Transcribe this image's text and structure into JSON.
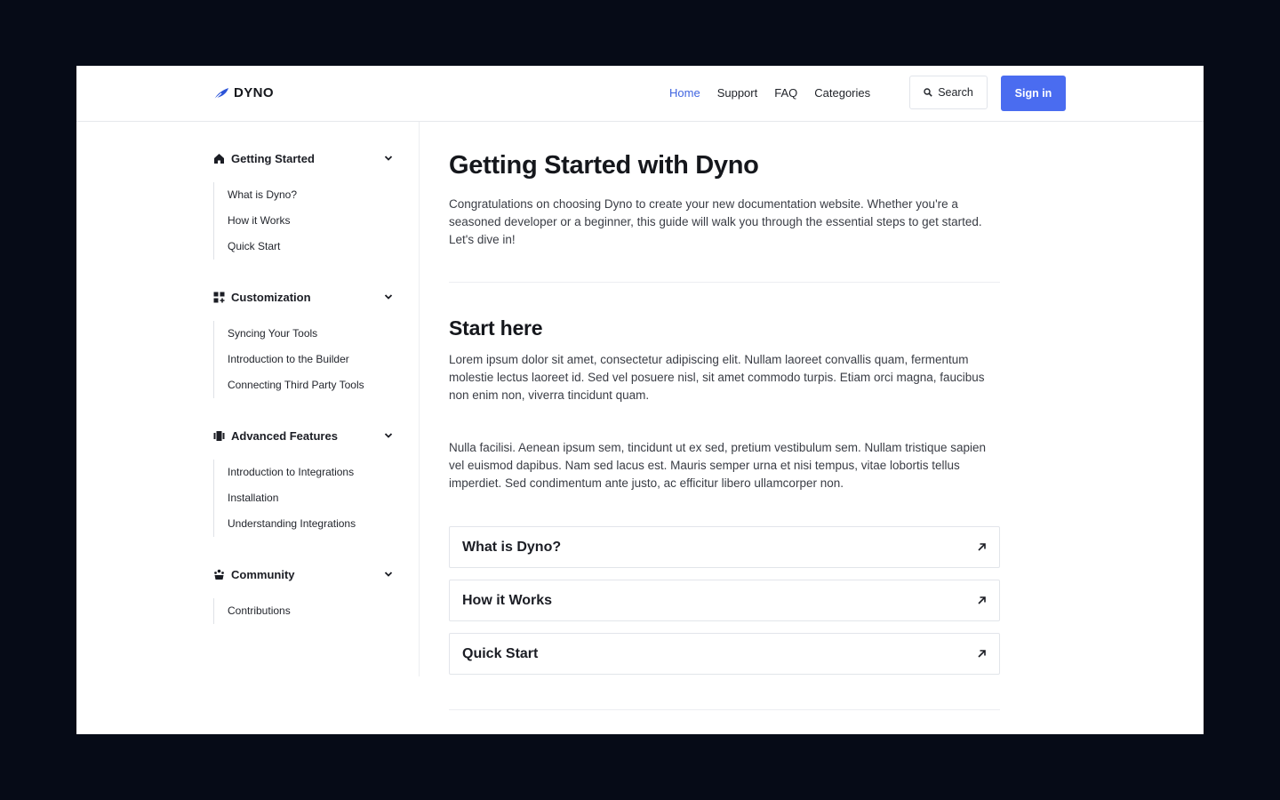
{
  "brand": {
    "name": "DYNO",
    "accent": "#3f64e0",
    "button_color": "#4a6cf0"
  },
  "header": {
    "nav": [
      {
        "label": "Home",
        "active": true
      },
      {
        "label": "Support",
        "active": false
      },
      {
        "label": "FAQ",
        "active": false
      },
      {
        "label": "Categories",
        "active": false
      }
    ],
    "search_label": "Search",
    "signin_label": "Sign in"
  },
  "sidebar": {
    "sections": [
      {
        "label": "Getting Started",
        "icon": "home-icon",
        "items": [
          "What is Dyno?",
          "How it Works",
          "Quick Start"
        ]
      },
      {
        "label": "Customization",
        "icon": "grid-plus-icon",
        "items": [
          "Syncing Your Tools",
          "Introduction to the Builder",
          "Connecting Third Party Tools"
        ]
      },
      {
        "label": "Advanced Features",
        "icon": "carousel-icon",
        "items": [
          "Introduction to Integrations",
          "Installation",
          "Understanding Integrations"
        ]
      },
      {
        "label": "Community",
        "icon": "community-icon",
        "items": [
          "Contributions"
        ]
      }
    ]
  },
  "main": {
    "title": "Getting Started with Dyno",
    "lead": "Congratulations on choosing Dyno to create your new documentation website. Whether you're a seasoned developer or a beginner, this guide will walk you through the essential steps to get started. Let's dive in!",
    "section_title": "Start here",
    "paragraphs": [
      "Lorem ipsum dolor sit amet, consectetur adipiscing elit. Nullam laoreet convallis quam, fermentum molestie lectus laoreet id. Sed vel posuere nisl, sit amet commodo turpis. Etiam orci magna, faucibus non enim non, viverra tincidunt quam.",
      "Nulla facilisi. Aenean ipsum sem, tincidunt ut ex sed, pretium vestibulum sem. Nullam tristique sapien vel euismod dapibus. Nam sed lacus est. Mauris semper urna et nisi tempus, vitae lobortis tellus imperdiet. Sed condimentum ante justo, ac efficitur libero ullamcorper non."
    ],
    "cards": [
      {
        "label": "What is Dyno?",
        "icon": "arrow-up-right-icon"
      },
      {
        "label": "How it Works",
        "icon": "arrow-up-right-icon"
      },
      {
        "label": "Quick Start",
        "icon": "arrow-up-right-icon"
      }
    ]
  }
}
